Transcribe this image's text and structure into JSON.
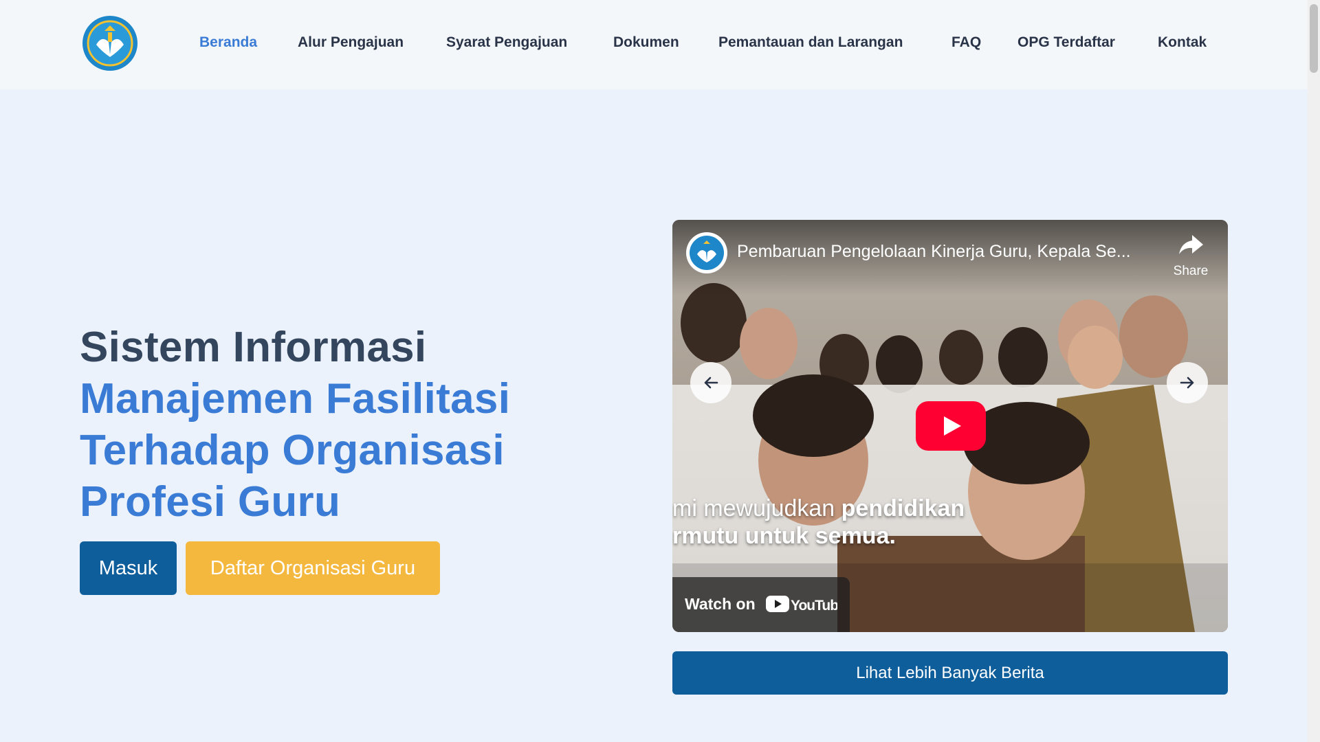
{
  "header": {
    "logo_icon": "tut-wuri-handayani-logo",
    "nav": [
      {
        "label": "Beranda",
        "active": true
      },
      {
        "label": "Alur Pengajuan",
        "active": false
      },
      {
        "label": "Syarat Pengajuan",
        "active": false
      },
      {
        "label": "Dokumen",
        "active": false
      },
      {
        "label": "Pemantauan dan Larangan",
        "active": false
      },
      {
        "label": "FAQ",
        "active": false
      },
      {
        "label": "OPG Terdaftar",
        "active": false
      },
      {
        "label": "Kontak",
        "active": false
      }
    ]
  },
  "hero": {
    "title_line1": "Sistem Informasi",
    "title_line2": "Manajemen Fasilitasi",
    "title_line3": "Terhadap Organisasi",
    "title_line4": "Profesi Guru",
    "login_button": "Masuk",
    "register_button": "Daftar Organisasi Guru"
  },
  "video": {
    "title": "Pembaruan Pengelolaan Kinerja Guru, Kepala Se...",
    "share_label": "Share",
    "caption_line1_light": "mi mewujudkan ",
    "caption_line1_bold": "pendidikan",
    "caption_line2": "rmutu untuk semua.",
    "watch_label": "Watch on",
    "youtube_label": "YouTube"
  },
  "news_button": "Lihat Lebih Banyak Berita",
  "colors": {
    "brand_blue": "#0f5e9c",
    "accent_blue": "#3a7bd5",
    "brand_yellow": "#f5b83e",
    "youtube_red": "#ff0033"
  }
}
